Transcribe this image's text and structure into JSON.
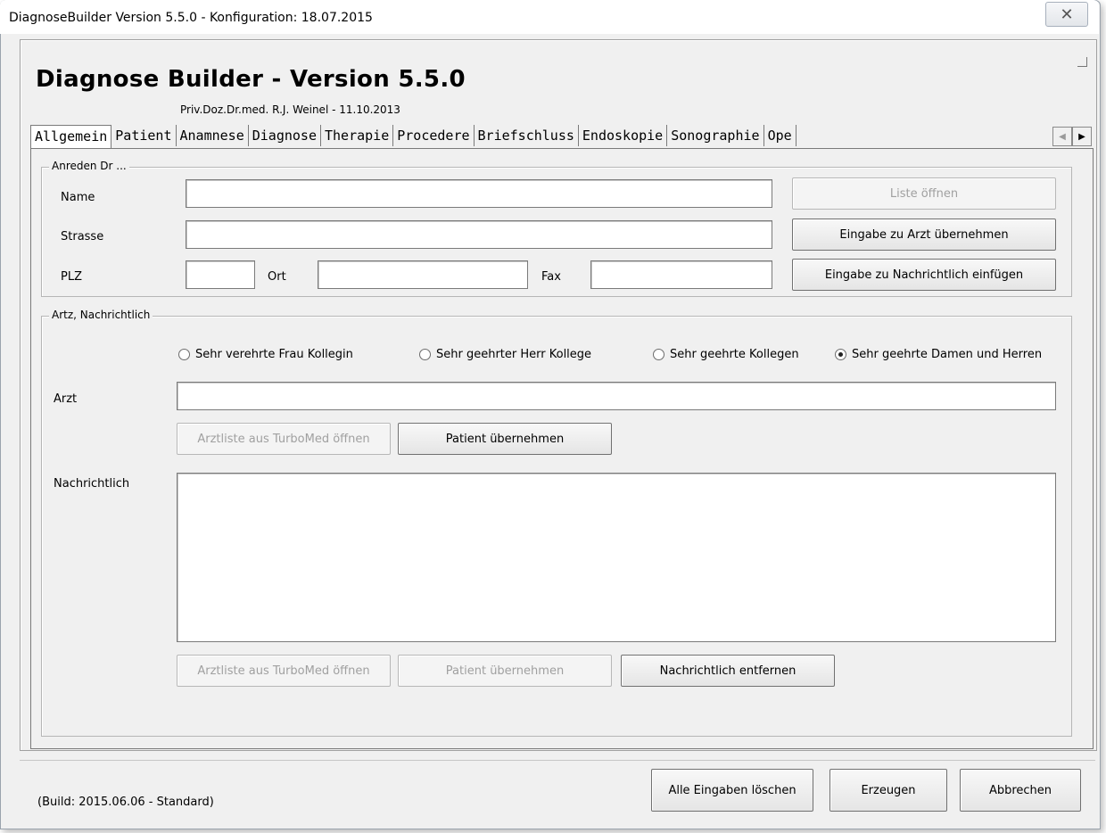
{
  "window": {
    "title": "DiagnoseBuilder Version 5.5.0 - Konfiguration: 18.07.2015",
    "close_glyph": "✕"
  },
  "app": {
    "title": "Diagnose Builder - Version 5.5.0",
    "subtitle": "Priv.Doz.Dr.med. R.J. Weinel - 11.10.2013"
  },
  "tabs": [
    {
      "label": "Allgemein",
      "active": true
    },
    {
      "label": "Patient"
    },
    {
      "label": "Anamnese"
    },
    {
      "label": "Diagnose"
    },
    {
      "label": "Therapie"
    },
    {
      "label": "Procedere"
    },
    {
      "label": "Briefschluss"
    },
    {
      "label": "Endoskopie"
    },
    {
      "label": "Sonographie"
    },
    {
      "label": "Ope"
    }
  ],
  "tab_scroll": {
    "left": "◀",
    "right": "▶"
  },
  "anreden": {
    "caption": "Anreden Dr ...",
    "name_label": "Name",
    "name_value": "",
    "strasse_label": "Strasse",
    "strasse_value": "",
    "plz_label": "PLZ",
    "plz_value": "",
    "ort_label": "Ort",
    "ort_value": "",
    "fax_label": "Fax",
    "fax_value": "",
    "btn_liste": "Liste öffnen",
    "btn_arzt": "Eingabe zu Arzt übernehmen",
    "btn_nachrichtlich": "Eingabe zu Nachrichtlich einfügen"
  },
  "artz": {
    "caption": "Artz, Nachrichtlich",
    "radios": [
      {
        "label": "Sehr verehrte Frau Kollegin",
        "checked": false
      },
      {
        "label": "Sehr geehrter Herr Kollege",
        "checked": false
      },
      {
        "label": "Sehr geehrte Kollegen",
        "checked": false
      },
      {
        "label": "Sehr geehrte Damen und Herren",
        "checked": true
      }
    ],
    "arzt_label": "Arzt",
    "arzt_value": "",
    "btn_arztliste": "Arztliste aus TurboMed öffnen",
    "btn_patient": "Patient übernehmen",
    "nachrichtlich_label": "Nachrichtlich",
    "nachrichtlich_value": "",
    "btn_arztliste2": "Arztliste aus TurboMed öffnen",
    "btn_patient2": "Patient übernehmen",
    "btn_entfernen": "Nachrichtlich entfernen"
  },
  "footer": {
    "build": "(Build: 2015.06.06 - Standard)",
    "btn_loeschen": "Alle Eingaben löschen",
    "btn_erzeugen": "Erzeugen",
    "btn_abbrechen": "Abbrechen"
  }
}
